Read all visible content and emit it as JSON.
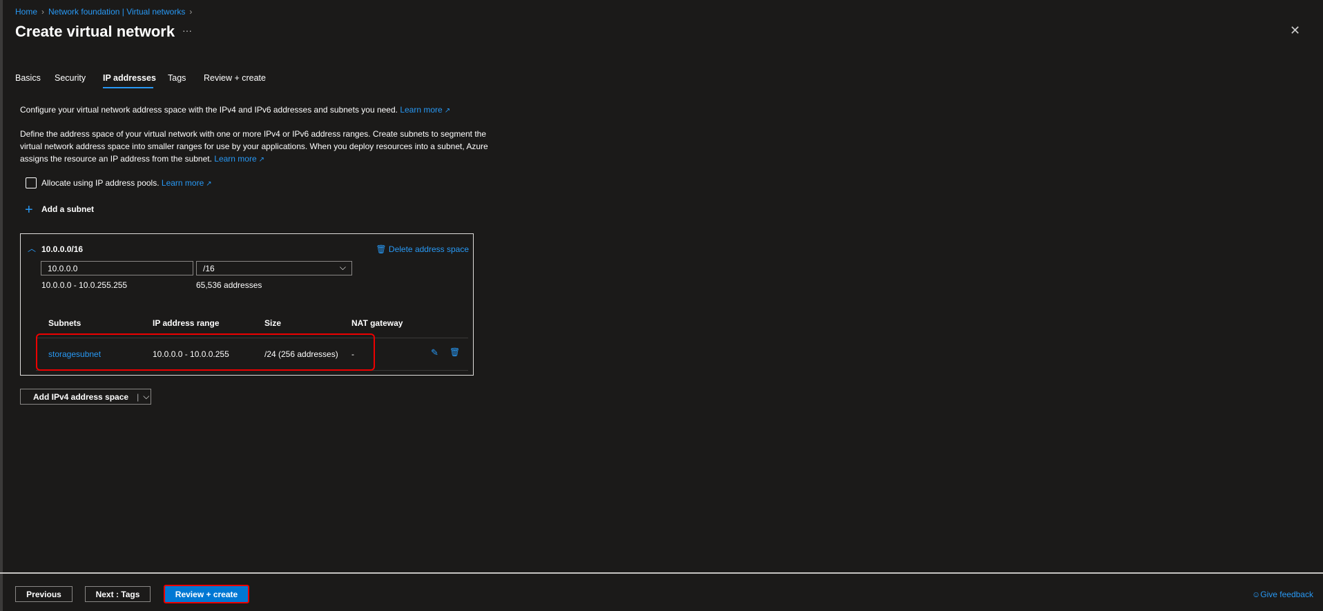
{
  "breadcrumb": [
    "Home",
    "Network foundation | Virtual networks"
  ],
  "title": "Create virtual network",
  "more": "···",
  "close": "✕",
  "tabs": [
    "Basics",
    "Security",
    "IP addresses",
    "Tags",
    "Review + create"
  ],
  "intro": "Configure your virtual network address space with the IPv4 and IPv6 addresses and subnets you need.",
  "learn_more": "Learn more",
  "define_lines": [
    "Define the address space of your virtual network with one or more IPv4 or IPv6 address ranges. Create subnets to segment the",
    "virtual network address space into smaller ranges for use by your applications. When you deploy resources into a subnet, Azure",
    "assigns the resource an IP address from the subnet."
  ],
  "allocate_label": "Allocate using IP address pools.",
  "add_subnet": "Add a subnet",
  "address_space": {
    "title": "10.0.0.0/16",
    "delete": "Delete address space",
    "address": "10.0.0.0",
    "prefix": "/16",
    "range": "10.0.0.0 - 10.0.255.255",
    "count": "65,536 addresses",
    "columns": [
      "Subnets",
      "IP address range",
      "Size",
      "NAT gateway"
    ],
    "rows": [
      {
        "name": "storagesubnet",
        "range": "10.0.0.0 - 10.0.0.255",
        "size": "/24 (256 addresses)",
        "nat": "-"
      }
    ]
  },
  "add_ipv4": "Add IPv4 address space",
  "footer": {
    "previous": "Previous",
    "next": "Next : Tags",
    "review": "Review + create",
    "feedback": "Give feedback"
  },
  "colors": {
    "accent": "#2899f5",
    "primary_button": "#0078d4",
    "highlight": "#e00000"
  }
}
